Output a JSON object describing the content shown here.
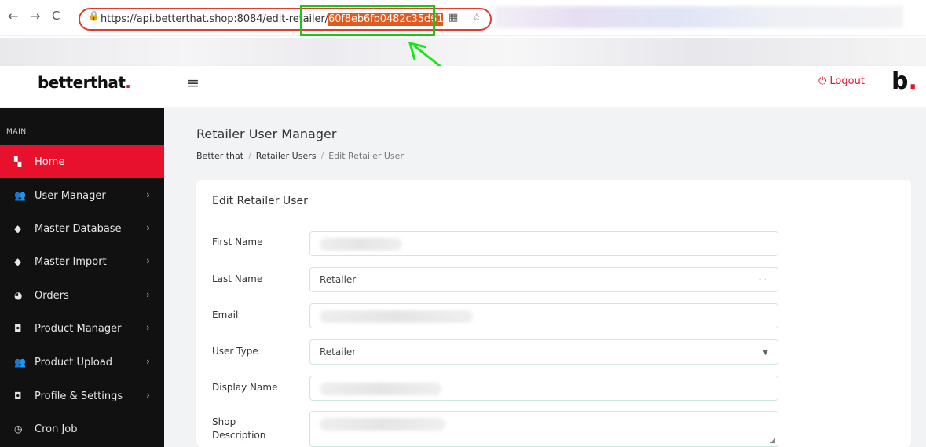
{
  "browser": {
    "back_icon": "←",
    "forward_icon": "→",
    "reload_icon": "C",
    "url_prefix": "https://api.betterthat.shop:8084/edit-retailer/",
    "url_highlight": "60f8eb6fb0482c35d61",
    "icons": [
      "lock-icon",
      "copy-icon",
      "qr-icon",
      "star-icon"
    ]
  },
  "header": {
    "brand": "betterthat",
    "brand_dot": ".",
    "logout_label": "⏻ Logout",
    "logo_letter": "b",
    "logo_dot": ".",
    "accent_color": "#e8112d"
  },
  "sidebar": {
    "section_title": "MAIN",
    "items": [
      {
        "label": "Home",
        "icon": "grid-icon",
        "active": true
      },
      {
        "label": "User Manager",
        "icon": "users-icon"
      },
      {
        "label": "Master Database",
        "icon": "shield-icon"
      },
      {
        "label": "Master Import",
        "icon": "shield-icon"
      },
      {
        "label": "Orders",
        "icon": "pie-icon"
      },
      {
        "label": "Product Manager",
        "icon": "box-icon"
      },
      {
        "label": "Product Upload",
        "icon": "users-icon"
      },
      {
        "label": "Profile & Settings",
        "icon": "box-icon"
      },
      {
        "label": "Cron Job",
        "icon": "clock-icon"
      }
    ]
  },
  "main": {
    "page_title": "Retailer User Manager",
    "breadcrumbs": [
      "Better that",
      "Retailer Users",
      "Edit Retailer User"
    ],
    "card_title": "Edit Retailer User",
    "fields": [
      {
        "label": "First Name",
        "value": ""
      },
      {
        "label": "Last Name",
        "value": "Retailer"
      },
      {
        "label": "Email",
        "value": ""
      },
      {
        "label": "User Type",
        "value": "Retailer"
      },
      {
        "label": "Display Name",
        "value": ""
      },
      {
        "label": "Shop Description",
        "value": ""
      }
    ]
  }
}
